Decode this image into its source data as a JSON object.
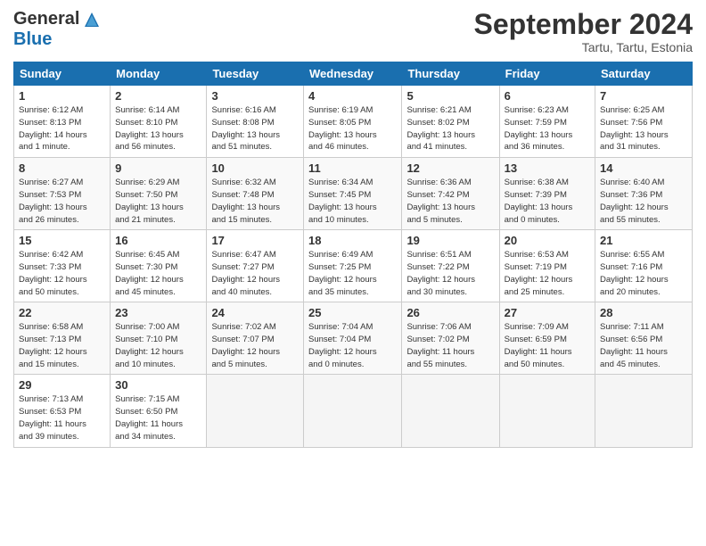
{
  "logo": {
    "general": "General",
    "blue": "Blue"
  },
  "title": "September 2024",
  "location": "Tartu, Tartu, Estonia",
  "headers": [
    "Sunday",
    "Monday",
    "Tuesday",
    "Wednesday",
    "Thursday",
    "Friday",
    "Saturday"
  ],
  "weeks": [
    [
      {
        "day": "1",
        "sunrise": "6:12 AM",
        "sunset": "8:13 PM",
        "daylight": "14 hours and 1 minute."
      },
      {
        "day": "2",
        "sunrise": "6:14 AM",
        "sunset": "8:10 PM",
        "daylight": "13 hours and 56 minutes."
      },
      {
        "day": "3",
        "sunrise": "6:16 AM",
        "sunset": "8:08 PM",
        "daylight": "13 hours and 51 minutes."
      },
      {
        "day": "4",
        "sunrise": "6:19 AM",
        "sunset": "8:05 PM",
        "daylight": "13 hours and 46 minutes."
      },
      {
        "day": "5",
        "sunrise": "6:21 AM",
        "sunset": "8:02 PM",
        "daylight": "13 hours and 41 minutes."
      },
      {
        "day": "6",
        "sunrise": "6:23 AM",
        "sunset": "7:59 PM",
        "daylight": "13 hours and 36 minutes."
      },
      {
        "day": "7",
        "sunrise": "6:25 AM",
        "sunset": "7:56 PM",
        "daylight": "13 hours and 31 minutes."
      }
    ],
    [
      {
        "day": "8",
        "sunrise": "6:27 AM",
        "sunset": "7:53 PM",
        "daylight": "13 hours and 26 minutes."
      },
      {
        "day": "9",
        "sunrise": "6:29 AM",
        "sunset": "7:50 PM",
        "daylight": "13 hours and 21 minutes."
      },
      {
        "day": "10",
        "sunrise": "6:32 AM",
        "sunset": "7:48 PM",
        "daylight": "13 hours and 15 minutes."
      },
      {
        "day": "11",
        "sunrise": "6:34 AM",
        "sunset": "7:45 PM",
        "daylight": "13 hours and 10 minutes."
      },
      {
        "day": "12",
        "sunrise": "6:36 AM",
        "sunset": "7:42 PM",
        "daylight": "13 hours and 5 minutes."
      },
      {
        "day": "13",
        "sunrise": "6:38 AM",
        "sunset": "7:39 PM",
        "daylight": "13 hours and 0 minutes."
      },
      {
        "day": "14",
        "sunrise": "6:40 AM",
        "sunset": "7:36 PM",
        "daylight": "12 hours and 55 minutes."
      }
    ],
    [
      {
        "day": "15",
        "sunrise": "6:42 AM",
        "sunset": "7:33 PM",
        "daylight": "12 hours and 50 minutes."
      },
      {
        "day": "16",
        "sunrise": "6:45 AM",
        "sunset": "7:30 PM",
        "daylight": "12 hours and 45 minutes."
      },
      {
        "day": "17",
        "sunrise": "6:47 AM",
        "sunset": "7:27 PM",
        "daylight": "12 hours and 40 minutes."
      },
      {
        "day": "18",
        "sunrise": "6:49 AM",
        "sunset": "7:25 PM",
        "daylight": "12 hours and 35 minutes."
      },
      {
        "day": "19",
        "sunrise": "6:51 AM",
        "sunset": "7:22 PM",
        "daylight": "12 hours and 30 minutes."
      },
      {
        "day": "20",
        "sunrise": "6:53 AM",
        "sunset": "7:19 PM",
        "daylight": "12 hours and 25 minutes."
      },
      {
        "day": "21",
        "sunrise": "6:55 AM",
        "sunset": "7:16 PM",
        "daylight": "12 hours and 20 minutes."
      }
    ],
    [
      {
        "day": "22",
        "sunrise": "6:58 AM",
        "sunset": "7:13 PM",
        "daylight": "12 hours and 15 minutes."
      },
      {
        "day": "23",
        "sunrise": "7:00 AM",
        "sunset": "7:10 PM",
        "daylight": "12 hours and 10 minutes."
      },
      {
        "day": "24",
        "sunrise": "7:02 AM",
        "sunset": "7:07 PM",
        "daylight": "12 hours and 5 minutes."
      },
      {
        "day": "25",
        "sunrise": "7:04 AM",
        "sunset": "7:04 PM",
        "daylight": "12 hours and 0 minutes."
      },
      {
        "day": "26",
        "sunrise": "7:06 AM",
        "sunset": "7:02 PM",
        "daylight": "11 hours and 55 minutes."
      },
      {
        "day": "27",
        "sunrise": "7:09 AM",
        "sunset": "6:59 PM",
        "daylight": "11 hours and 50 minutes."
      },
      {
        "day": "28",
        "sunrise": "7:11 AM",
        "sunset": "6:56 PM",
        "daylight": "11 hours and 45 minutes."
      }
    ],
    [
      {
        "day": "29",
        "sunrise": "7:13 AM",
        "sunset": "6:53 PM",
        "daylight": "11 hours and 39 minutes."
      },
      {
        "day": "30",
        "sunrise": "7:15 AM",
        "sunset": "6:50 PM",
        "daylight": "11 hours and 34 minutes."
      },
      null,
      null,
      null,
      null,
      null
    ]
  ]
}
